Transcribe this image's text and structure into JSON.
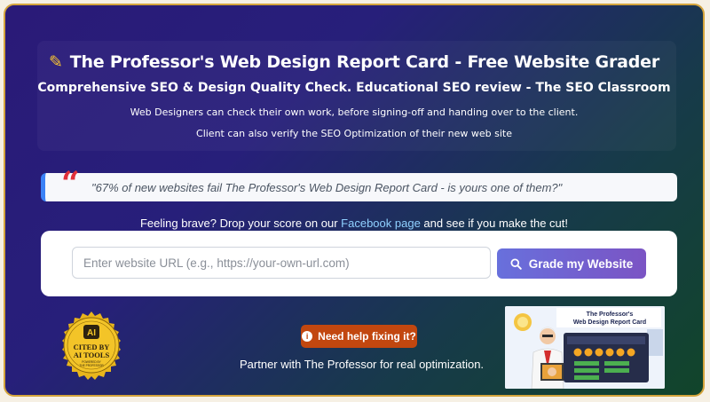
{
  "header": {
    "title": "The Professor's Web Design Report Card - Free Website Grader",
    "subtitle": "Comprehensive SEO & Design Quality Check. Educational SEO review - The SEO Classroom",
    "tagline_1": "Web Designers can check their own work, before signing-off and handing over to the client.",
    "tagline_2": "Client can also verify the SEO Optimization of their new web site"
  },
  "quote": {
    "text": "\"67% of new websites fail The Professor's Web Design Report Card - is yours one of them?\""
  },
  "challenge": {
    "prefix": "Feeling brave? Drop your score on our ",
    "link_text": "Facebook page",
    "suffix": " and see if you make the cut!"
  },
  "form": {
    "url_placeholder": "Enter website URL (e.g., https://your-own-url.com)",
    "url_value": "",
    "submit_label": "Grade my Website"
  },
  "badge": {
    "monogram": "AI",
    "line1": "CITED BY",
    "line2": "AI TOOLS",
    "line3": "POWERED BY",
    "line4": "THE PROFESSOR"
  },
  "help": {
    "button_label": "Need help fixing it?",
    "partner_text": "Partner with The Professor for real optimization."
  },
  "promo": {
    "heading_1": "The Professor's",
    "heading_2": "Web Design Report Card"
  },
  "colors": {
    "accent_gold": "#f5c233",
    "quote_mark": "#e0303a",
    "link": "#8fd0ff",
    "button_start": "#6870dc",
    "button_end": "#7b54c4",
    "help_button": "#c2470f"
  },
  "icons": {
    "title_icon": "pencil-square-icon",
    "search_icon": "search-icon",
    "info_icon": "info-icon",
    "quote_icon": "quote-icon"
  }
}
